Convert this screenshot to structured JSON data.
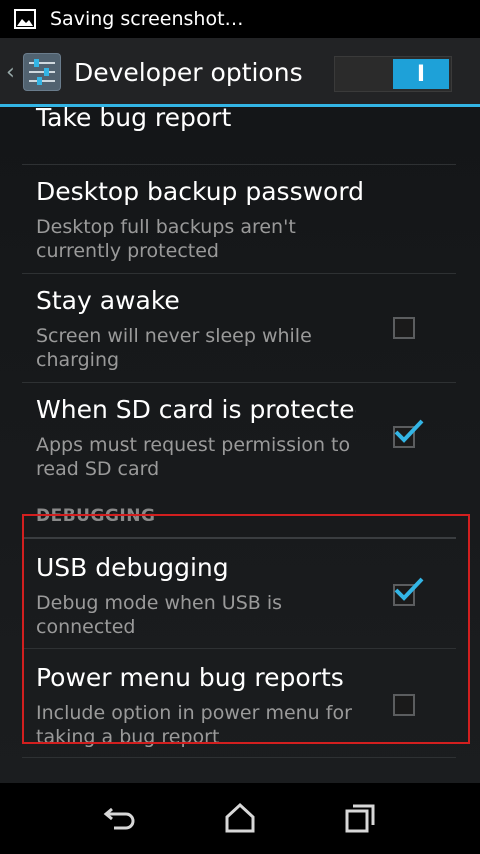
{
  "status_bar": {
    "notification_text": "Saving screenshot…",
    "icon": "image-icon"
  },
  "action_bar": {
    "title": "Developer options",
    "toggle_state": "on",
    "toggle_label": "I",
    "icon": "settings-sliders-icon",
    "accent": "#33b5e5"
  },
  "settings": {
    "items": [
      {
        "title": "Take bug report",
        "summary": ""
      },
      {
        "title": "Desktop backup password",
        "summary": "Desktop full backups aren't currently protected"
      },
      {
        "title": "Stay awake",
        "summary": "Screen will never sleep while charging",
        "checked": false
      },
      {
        "title": "When SD card is protected",
        "summary": "Apps must request permission to read SD card",
        "checked": true
      }
    ],
    "debugging_header": "DEBUGGING",
    "debug_items": [
      {
        "title": "USB debugging",
        "summary": "Debug mode when USB is connected",
        "checked": true
      },
      {
        "title": "Power menu bug reports",
        "summary": "Include option in power menu for taking a bug report",
        "checked": false
      }
    ]
  },
  "nav_bar": {
    "icons": [
      "back-icon",
      "home-icon",
      "recent-apps-icon"
    ]
  },
  "colors": {
    "highlight": "#d21f1f",
    "checkmark": "#33b5e5"
  }
}
